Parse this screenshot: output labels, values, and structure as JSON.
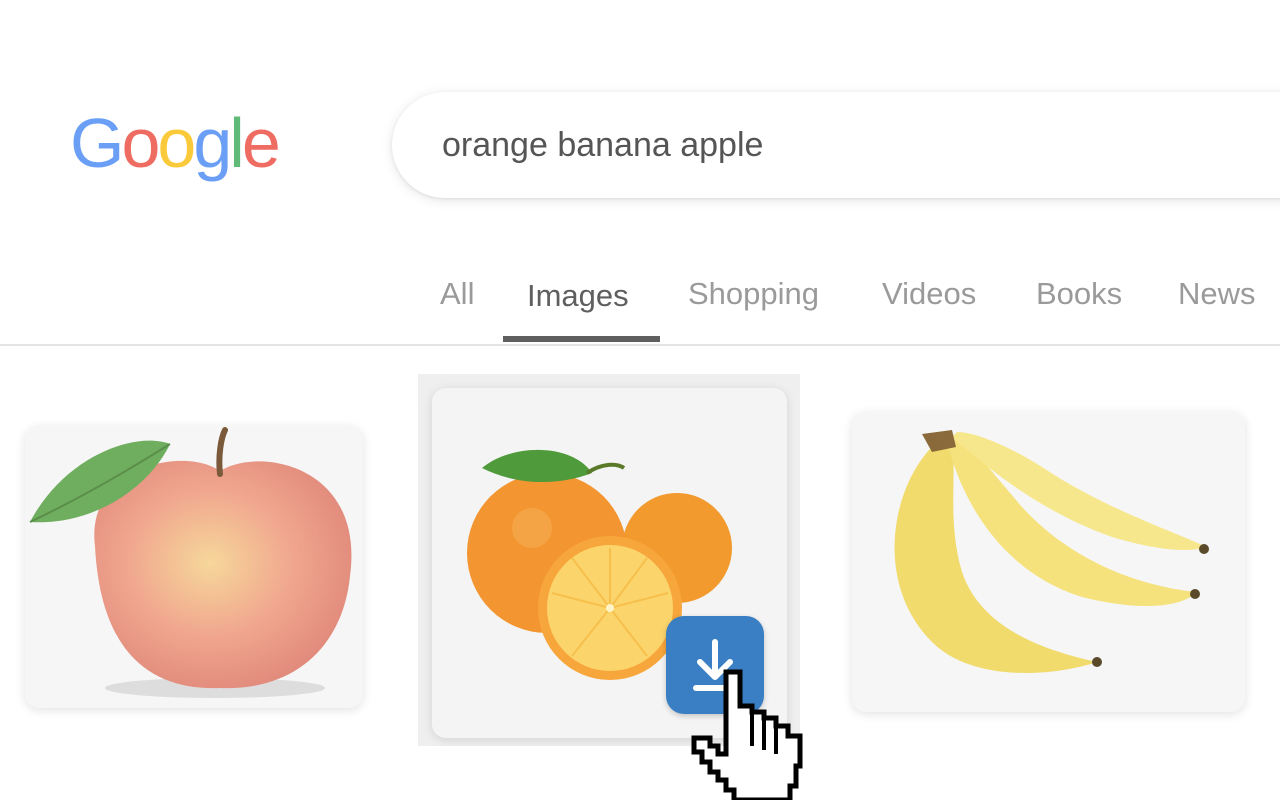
{
  "logo": {
    "letters": [
      "G",
      "o",
      "o",
      "g",
      "l",
      "e"
    ],
    "colors": [
      "#4285F4",
      "#EA4335",
      "#FBBC05",
      "#4285F4",
      "#34A853",
      "#EA4335"
    ]
  },
  "search": {
    "query": "orange banana apple"
  },
  "tabs": [
    {
      "label": "All",
      "active": false
    },
    {
      "label": "Images",
      "active": true
    },
    {
      "label": "Shopping",
      "active": false
    },
    {
      "label": "Videos",
      "active": false
    },
    {
      "label": "Books",
      "active": false
    },
    {
      "label": "News",
      "active": false
    }
  ],
  "results": [
    {
      "subject": "apple"
    },
    {
      "subject": "orange"
    },
    {
      "subject": "banana"
    }
  ],
  "download_button": {
    "icon": "download-arrow-icon",
    "color": "#3a7fc4"
  },
  "cursor": {
    "icon": "hand-pointer-icon"
  }
}
